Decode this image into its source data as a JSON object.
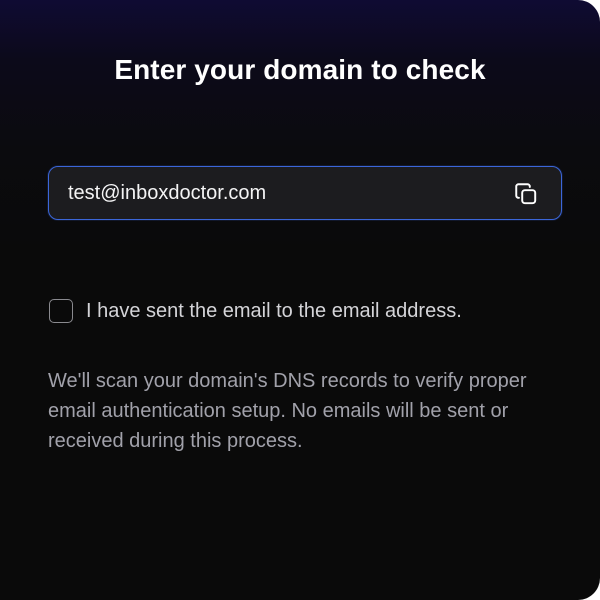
{
  "header": {
    "title": "Enter your domain to check"
  },
  "email_field": {
    "value": "test@inboxdoctor.com",
    "copy_icon": "copy-icon"
  },
  "confirmation": {
    "checked": false,
    "label": "I have sent the email to the email address."
  },
  "info": {
    "text": "We'll scan your domain's DNS records to verify proper email authentication setup. No emails will be sent or received during this process."
  },
  "colors": {
    "accent_border": "#3b66d9",
    "background": "#0a0a0a",
    "top_glow": "#0f0b33",
    "title_text": "#ffffff",
    "body_text": "#a1a1aa"
  }
}
